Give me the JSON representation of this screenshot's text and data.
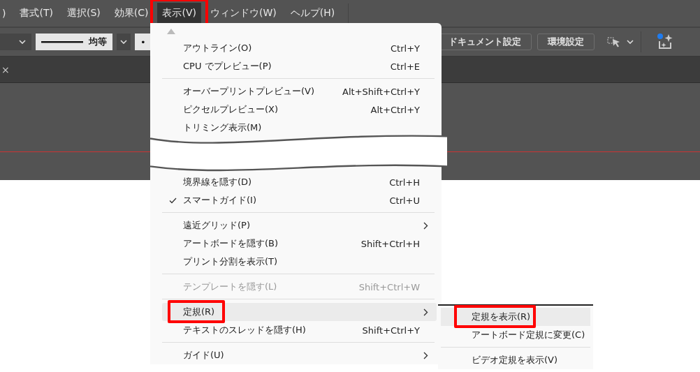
{
  "menubar": [
    {
      "label": ")",
      "selected": false,
      "annotated": false
    },
    {
      "label": "書式(T)",
      "selected": false,
      "annotated": false
    },
    {
      "label": "選択(S)",
      "selected": false,
      "annotated": false
    },
    {
      "label": "効果(C)",
      "selected": false,
      "annotated": false
    },
    {
      "label": "表示(V)",
      "selected": true,
      "annotated": true
    },
    {
      "label": "ウィンドウ(W)",
      "selected": false,
      "annotated": false
    },
    {
      "label": "ヘルプ(H)",
      "selected": false,
      "annotated": false
    }
  ],
  "toolbar": {
    "stroke_profile": "均等",
    "bullet": "•",
    "buttons": [
      "ドキュメント設定",
      "環境設定"
    ]
  },
  "tab_close": "×",
  "view_menu": [
    {
      "kind": "item",
      "label": "アウトライン(O)",
      "shortcut": "Ctrl+Y",
      "checked": false,
      "disabled": false,
      "highlighted": false,
      "has_submenu": false,
      "annotated": false
    },
    {
      "kind": "item",
      "label": "CPU でプレビュー(P)",
      "shortcut": "Ctrl+E",
      "checked": false,
      "disabled": false,
      "highlighted": false,
      "has_submenu": false,
      "annotated": false
    },
    {
      "kind": "separator"
    },
    {
      "kind": "item",
      "label": "オーバープリントプレビュー(V)",
      "shortcut": "Alt+Shift+Ctrl+Y",
      "checked": false,
      "disabled": false,
      "highlighted": false,
      "has_submenu": false,
      "annotated": false
    },
    {
      "kind": "item",
      "label": "ピクセルプレビュー(X)",
      "shortcut": "Alt+Ctrl+Y",
      "checked": false,
      "disabled": false,
      "highlighted": false,
      "has_submenu": false,
      "annotated": false
    },
    {
      "kind": "item",
      "label": "トリミング表示(M)",
      "checked": false,
      "disabled": false,
      "highlighted": false,
      "has_submenu": false,
      "annotated": false
    },
    {
      "kind": "tear"
    },
    {
      "kind": "item",
      "label": "境界線を隠す(D)",
      "shortcut": "Ctrl+H",
      "checked": false,
      "disabled": false,
      "highlighted": false,
      "has_submenu": false,
      "annotated": false
    },
    {
      "kind": "item",
      "label": "スマートガイド(I)",
      "shortcut": "Ctrl+U",
      "checked": true,
      "disabled": false,
      "highlighted": false,
      "has_submenu": false,
      "annotated": false
    },
    {
      "kind": "separator"
    },
    {
      "kind": "item",
      "label": "遠近グリッド(P)",
      "checked": false,
      "disabled": false,
      "highlighted": false,
      "has_submenu": true,
      "annotated": false
    },
    {
      "kind": "item",
      "label": "アートボードを隠す(B)",
      "shortcut": "Shift+Ctrl+H",
      "checked": false,
      "disabled": false,
      "highlighted": false,
      "has_submenu": false,
      "annotated": false
    },
    {
      "kind": "item",
      "label": "プリント分割を表示(T)",
      "checked": false,
      "disabled": false,
      "highlighted": false,
      "has_submenu": false,
      "annotated": false
    },
    {
      "kind": "separator"
    },
    {
      "kind": "item",
      "label": "テンプレートを隠す(L)",
      "shortcut": "Shift+Ctrl+W",
      "checked": false,
      "disabled": true,
      "highlighted": false,
      "has_submenu": false,
      "annotated": false
    },
    {
      "kind": "separator"
    },
    {
      "kind": "item",
      "label": "定規(R)",
      "checked": false,
      "disabled": false,
      "highlighted": true,
      "has_submenu": true,
      "annotated": true
    },
    {
      "kind": "item",
      "label": "テキストのスレッドを隠す(H)",
      "shortcut": "Shift+Ctrl+Y",
      "checked": false,
      "disabled": false,
      "highlighted": false,
      "has_submenu": false,
      "annotated": false
    },
    {
      "kind": "separator"
    },
    {
      "kind": "item",
      "label": "ガイド(U)",
      "checked": false,
      "disabled": false,
      "highlighted": false,
      "has_submenu": true,
      "annotated": false
    }
  ],
  "ruler_submenu": [
    {
      "kind": "item",
      "label": "定規を表示(R)",
      "highlighted": true,
      "annotated": true
    },
    {
      "kind": "item",
      "label": "アートボード定規に変更(C)",
      "highlighted": false,
      "annotated": false
    },
    {
      "kind": "separator"
    },
    {
      "kind": "item",
      "label": "ビデオ定規を表示(V)",
      "highlighted": false,
      "annotated": false
    }
  ]
}
